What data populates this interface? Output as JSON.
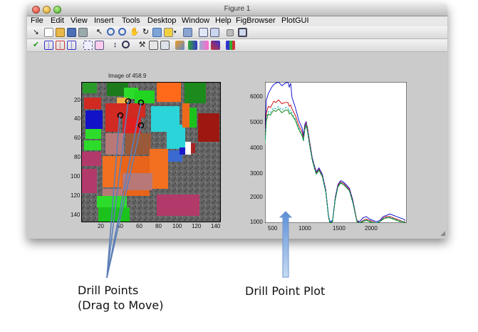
{
  "window": {
    "title": "Figure 1"
  },
  "menu": {
    "file": "File",
    "edit": "Edit",
    "view": "View",
    "insert": "Insert",
    "tools": "Tools",
    "desktop": "Desktop",
    "window": "Window",
    "help": "Help",
    "figbrowser": "FigBrowser",
    "plotgui": "PlotGUI"
  },
  "left_axes": {
    "title": "Image of 458.9",
    "xticks": [
      "20",
      "40",
      "60",
      "80",
      "100",
      "120",
      "140"
    ],
    "yticks": [
      "20",
      "40",
      "60",
      "80",
      "100",
      "120",
      "140"
    ]
  },
  "right_axes": {
    "xticks": [
      "500",
      "1000",
      "1500",
      "2000"
    ],
    "yticks": [
      "1000",
      "2000",
      "3000",
      "4000",
      "5000",
      "6000"
    ]
  },
  "annotations": {
    "drill_points_line1": "Drill Points",
    "drill_points_line2": "(Drag to Move)",
    "drill_point_plot": "Drill Point Plot"
  },
  "chart_data": {
    "type": "line",
    "xlim": [
      400,
      2500
    ],
    "ylim": [
      1000,
      6500
    ],
    "grid": false,
    "x": [
      400,
      420,
      450,
      480,
      500,
      530,
      560,
      600,
      650,
      700,
      740,
      760,
      780,
      800,
      850,
      900,
      950,
      970,
      990,
      1010,
      1030,
      1060,
      1100,
      1130,
      1160,
      1200,
      1250,
      1300,
      1340,
      1360,
      1400,
      1440,
      1480,
      1520,
      1560,
      1600,
      1650,
      1700,
      1760,
      1800,
      1850,
      1900,
      1950,
      2000,
      2050,
      2100,
      2150,
      2200,
      2250,
      2300,
      2350,
      2400,
      2450,
      2480
    ],
    "series": [
      {
        "color": "#0000cc",
        "values": [
          4400,
          5800,
          6050,
          6200,
          6300,
          6400,
          6450,
          6500,
          6350,
          6450,
          6500,
          6300,
          6450,
          5900,
          5500,
          5000,
          4700,
          4400,
          4850,
          4950,
          4700,
          4200,
          3550,
          3250,
          3000,
          3150,
          2900,
          2300,
          1300,
          1050,
          1100,
          2000,
          2500,
          2650,
          2600,
          2500,
          2350,
          1900,
          1100,
          1050,
          1200,
          1250,
          1150,
          1100,
          1050,
          1100,
          1250,
          1300,
          1350,
          1300,
          1250,
          1200,
          1150,
          1100
        ]
      },
      {
        "color": "#cc0000",
        "values": [
          4300,
          5300,
          5550,
          5500,
          5600,
          5750,
          5700,
          5800,
          5650,
          5700,
          5700,
          5550,
          5600,
          5450,
          5200,
          4800,
          4550,
          4300,
          4750,
          4900,
          4650,
          4150,
          3500,
          3200,
          2950,
          3100,
          2850,
          2250,
          1250,
          1000,
          1050,
          1950,
          2450,
          2600,
          2550,
          2450,
          2300,
          1850,
          1100,
          1000,
          1100,
          1150,
          1100,
          1050,
          1000,
          1050,
          1200,
          1250,
          1250,
          1200,
          1150,
          1100,
          1050,
          1050
        ]
      },
      {
        "color": "#007a00",
        "values": [
          4100,
          5000,
          5250,
          5200,
          5300,
          5400,
          5350,
          5450,
          5300,
          5400,
          5400,
          5250,
          5300,
          5200,
          5000,
          4650,
          4400,
          4200,
          4650,
          4800,
          4550,
          4050,
          3450,
          3150,
          2900,
          3050,
          2800,
          2200,
          1250,
          1000,
          1050,
          1900,
          2400,
          2550,
          2500,
          2400,
          2250,
          1800,
          1050,
          1000,
          1050,
          1100,
          1050,
          1000,
          1000,
          1050,
          1150,
          1200,
          1200,
          1150,
          1100,
          1050,
          1050,
          1000
        ]
      },
      {
        "color": "#00b0b0",
        "values": [
          4200,
          5100,
          5350,
          5300,
          5400,
          5500,
          5450,
          5550,
          5400,
          5500,
          5500,
          5350,
          5400,
          5300,
          5050,
          4700,
          4450,
          4250,
          4700,
          4850,
          4600,
          4100,
          3480,
          3180,
          2920,
          3080,
          2830,
          2230,
          1260,
          1020,
          1070,
          1920,
          2420,
          2580,
          2520,
          2420,
          2270,
          1820,
          1070,
          1010,
          1080,
          1120,
          1080,
          1030,
          1010,
          1060,
          1180,
          1220,
          1230,
          1180,
          1120,
          1080,
          1060,
          1030
        ]
      }
    ]
  }
}
